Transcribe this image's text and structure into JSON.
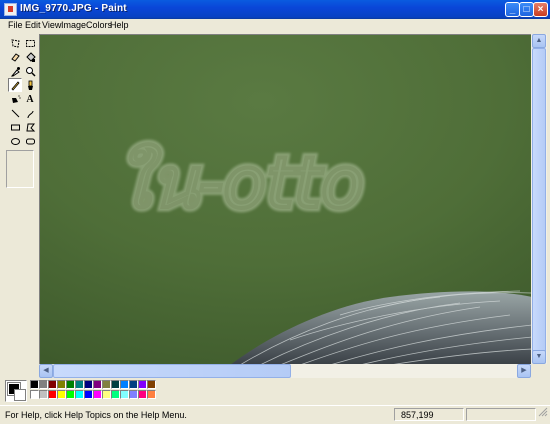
{
  "window": {
    "title": "IMG_9770.JPG - Paint"
  },
  "menu": [
    "File",
    "Edit",
    "View",
    "Image",
    "Colors",
    "Help"
  ],
  "tools": [
    "free-form-select",
    "select",
    "eraser",
    "fill-with-color",
    "pick-color",
    "magnifier",
    "pencil",
    "brush",
    "airbrush",
    "text",
    "line",
    "curve",
    "rectangle",
    "polygon",
    "ellipse",
    "rounded-rectangle"
  ],
  "selected_tool": "pencil",
  "canvas": {
    "watermark": "ใน-otto",
    "background_color": "#4d6a38"
  },
  "palette": {
    "foreground": "#000000",
    "background": "#ffffff",
    "colors": [
      "#000000",
      "#808080",
      "#800000",
      "#808000",
      "#008000",
      "#008080",
      "#000080",
      "#800080",
      "#808040",
      "#004040",
      "#0080ff",
      "#004080",
      "#8000ff",
      "#804000",
      "#ffffff",
      "#c0c0c0",
      "#ff0000",
      "#ffff00",
      "#00ff00",
      "#00ffff",
      "#0000ff",
      "#ff00ff",
      "#ffff80",
      "#00ff80",
      "#80ffff",
      "#8080ff",
      "#ff0080",
      "#ff8040"
    ]
  },
  "status": {
    "help": "For Help, click Help Topics on the Help Menu.",
    "coords": "857,199"
  }
}
